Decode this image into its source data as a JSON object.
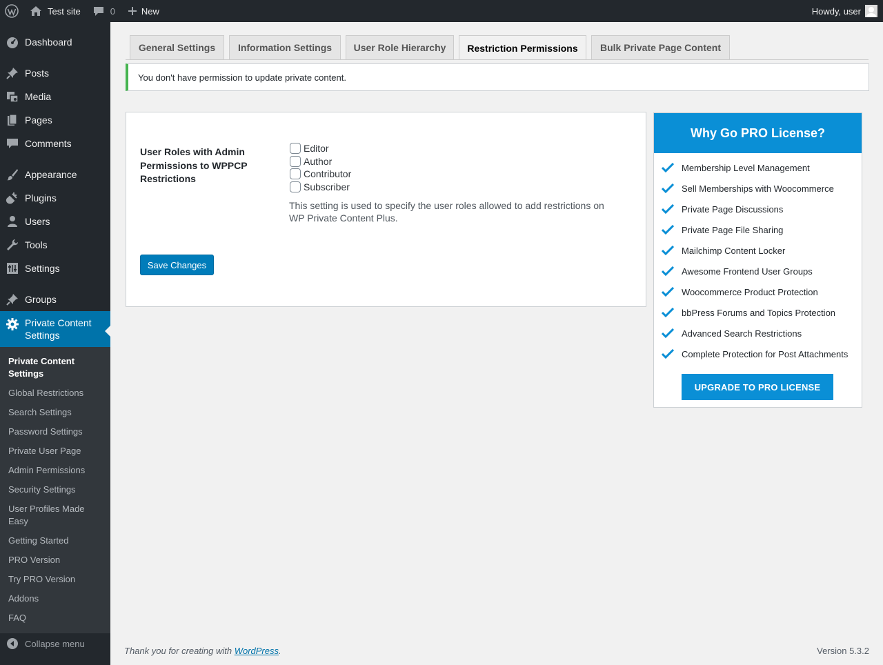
{
  "adminbar": {
    "site_name": "Test site",
    "comments_count": "0",
    "new_label": "New",
    "greeting": "Howdy, user"
  },
  "sidebar": {
    "items": [
      {
        "label": "Dashboard",
        "icon": "dashboard-icon"
      },
      {
        "label": "Posts",
        "icon": "pin-icon"
      },
      {
        "label": "Media",
        "icon": "media-icon"
      },
      {
        "label": "Pages",
        "icon": "pages-icon"
      },
      {
        "label": "Comments",
        "icon": "comment-icon"
      },
      {
        "label": "Appearance",
        "icon": "brush-icon"
      },
      {
        "label": "Plugins",
        "icon": "plug-icon"
      },
      {
        "label": "Users",
        "icon": "user-icon"
      },
      {
        "label": "Tools",
        "icon": "wrench-icon"
      },
      {
        "label": "Settings",
        "icon": "settings-icon"
      },
      {
        "label": "Groups",
        "icon": "pin-icon"
      },
      {
        "label": "Private Content Settings",
        "icon": "gear-icon"
      }
    ],
    "submenu": [
      "Private Content Settings",
      "Global Restrictions",
      "Search Settings",
      "Password Settings",
      "Private User Page",
      "Admin Permissions",
      "Security Settings",
      "User Profiles Made Easy",
      "Getting Started",
      "PRO Version",
      "Try PRO Version",
      "Addons",
      "FAQ"
    ],
    "collapse_label": "Collapse menu"
  },
  "tabs": [
    "General Settings",
    "Information Settings",
    "User Role Hierarchy",
    "Restriction Permissions",
    "Bulk Private Page Content"
  ],
  "notice": "You don't have permission to update private content.",
  "settings": {
    "field_label": "User Roles with Admin Permissions to WPPCP Restrictions",
    "roles": [
      "Editor",
      "Author",
      "Contributor",
      "Subscriber"
    ],
    "description": "This setting is used to specify the user roles allowed to add restrictions on WP Private Content Plus.",
    "save_label": "Save Changes"
  },
  "pro": {
    "title": "Why Go PRO License?",
    "features": [
      "Membership Level Management",
      "Sell Memberships with Woocommerce",
      "Private Page Discussions",
      "Private Page File Sharing",
      "Mailchimp Content Locker",
      "Awesome Frontend User Groups",
      "Woocommerce Product Protection",
      "bbPress Forums and Topics Protection",
      "Advanced Search Restrictions",
      "Complete Protection for Post Attachments"
    ],
    "upgrade_label": "UPGRADE TO PRO LICENSE"
  },
  "footer": {
    "thanks_prefix": "Thank you for creating with ",
    "wp_link": "WordPress",
    "thanks_suffix": ".",
    "version": "Version 5.3.2"
  },
  "colors": {
    "adminbar_bg": "#23282d",
    "accent": "#0073aa",
    "pro_blue": "#0a8fd6",
    "notice_green": "#46b450"
  }
}
